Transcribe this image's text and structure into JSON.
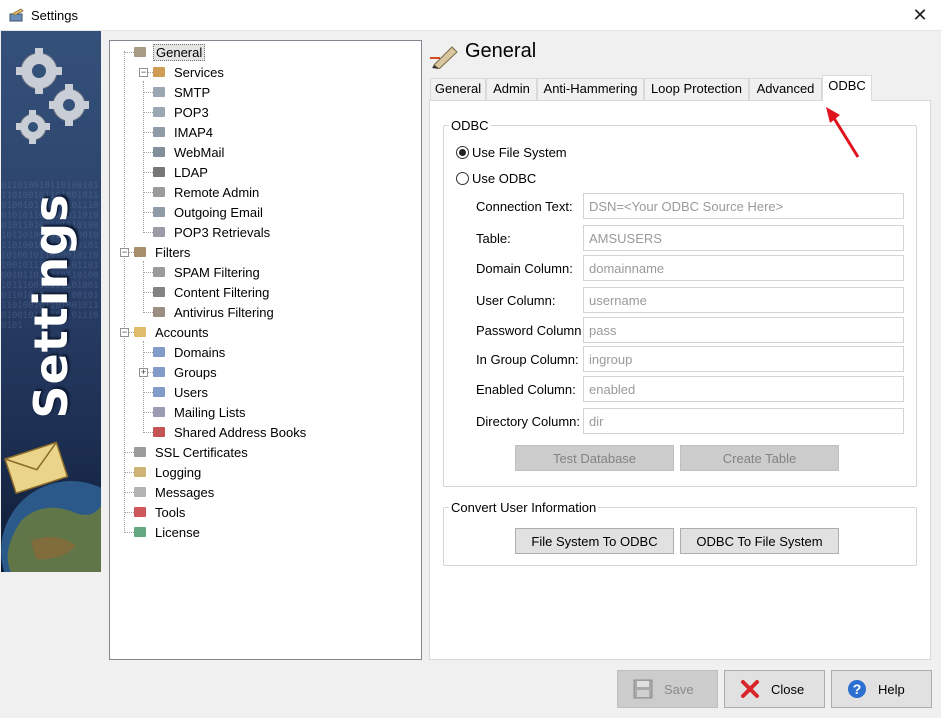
{
  "window": {
    "title": "Settings",
    "close_glyph": "✕"
  },
  "banner": {
    "text": "Settings",
    "digits": "0110100101101001011101001011010010110100101101001011100101011010010110100101101001011101001011010010110100101101001011100101011010010110100101101001011101001011010010110100101101001011100101011010010110100101101001011101001011010010110100101101001011100101"
  },
  "tree": {
    "items": [
      {
        "label": "General",
        "icon": "pen-icon",
        "selected": true
      },
      {
        "label": "Services",
        "icon": "services-icon"
      },
      {
        "label": "SMTP",
        "icon": "smtp-icon"
      },
      {
        "label": "POP3",
        "icon": "pop3-icon"
      },
      {
        "label": "IMAP4",
        "icon": "imap4-icon"
      },
      {
        "label": "WebMail",
        "icon": "webmail-icon"
      },
      {
        "label": "LDAP",
        "icon": "ldap-icon"
      },
      {
        "label": "Remote Admin",
        "icon": "remote-admin-icon"
      },
      {
        "label": "Outgoing Email",
        "icon": "outgoing-email-icon"
      },
      {
        "label": "POP3 Retrievals",
        "icon": "pop3-retrievals-icon"
      },
      {
        "label": "Filters",
        "icon": "filters-icon"
      },
      {
        "label": "SPAM Filtering",
        "icon": "spam-filter-icon"
      },
      {
        "label": "Content Filtering",
        "icon": "content-filter-icon"
      },
      {
        "label": "Antivirus Filtering",
        "icon": "antivirus-icon"
      },
      {
        "label": "Accounts",
        "icon": "folder-icon"
      },
      {
        "label": "Domains",
        "icon": "domains-icon"
      },
      {
        "label": "Groups",
        "icon": "groups-icon"
      },
      {
        "label": "Users",
        "icon": "users-icon"
      },
      {
        "label": "Mailing Lists",
        "icon": "mailing-lists-icon"
      },
      {
        "label": "Shared Address Books",
        "icon": "address-book-icon"
      },
      {
        "label": "SSL Certificates",
        "icon": "certificate-icon"
      },
      {
        "label": "Logging",
        "icon": "logging-icon"
      },
      {
        "label": "Messages",
        "icon": "messages-icon"
      },
      {
        "label": "Tools",
        "icon": "tools-icon"
      },
      {
        "label": "License",
        "icon": "license-icon"
      }
    ],
    "expander_minus": "−",
    "expander_plus": "+"
  },
  "header": {
    "title": "General"
  },
  "tabs": [
    "General",
    "Admin",
    "Anti-Hammering",
    "Loop Protection",
    "Advanced",
    "ODBC"
  ],
  "active_tab": "ODBC",
  "odbc": {
    "caption": "ODBC",
    "radio_file_system": "Use File System",
    "radio_odbc": "Use ODBC",
    "selected": "Use File System",
    "fields": [
      {
        "label": "Connection Text:",
        "value": "DSN=<Your ODBC Source Here>"
      },
      {
        "label": "Table:",
        "value": "AMSUSERS"
      },
      {
        "label": "Domain Column:",
        "value": "domainname"
      },
      {
        "label": "User Column:",
        "value": "username"
      },
      {
        "label": "Password Column",
        "value": "pass"
      },
      {
        "label": "In Group Column:",
        "value": "ingroup"
      },
      {
        "label": "Enabled Column:",
        "value": "enabled"
      },
      {
        "label": "Directory Column:",
        "value": "dir"
      }
    ],
    "test_database": "Test Database",
    "create_table": "Create Table"
  },
  "convert": {
    "caption": "Convert User Information",
    "to_odbc": "File System To ODBC",
    "to_fs": "ODBC To File System"
  },
  "footer": {
    "save": "Save",
    "close": "Close",
    "help": "Help"
  },
  "colors": {
    "banner_blue": "#2a4068",
    "arrow_red": "#e0141e",
    "close_red": "#d9262b",
    "help_blue": "#2d6fd0"
  }
}
